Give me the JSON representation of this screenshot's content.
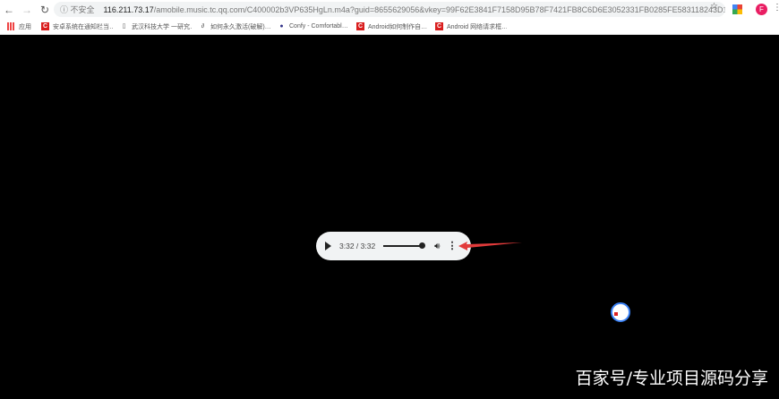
{
  "browser": {
    "security_label": "不安全",
    "url_host": "116.211.73.17",
    "url_path": "/amobile.music.tc.qq.com/C400002b3VP635HgLn.m4a?guid=8655629056&vkey=99F62E3841F7158D95B78F7421FB8C6D6E3052331FB0285FE583118243D1D...",
    "avatar_letter": "F"
  },
  "bookmarks": [
    {
      "label": "应用",
      "icon": "apps-icon"
    },
    {
      "label": "安卓系统在通知栏当…",
      "icon": "csdn-icon"
    },
    {
      "label": "武汉科技大学 一研究…",
      "icon": "page-icon"
    },
    {
      "label": "如何永久激活(破解)…",
      "icon": "link-icon"
    },
    {
      "label": "Confy - Comfortabl…",
      "icon": "confy-icon"
    },
    {
      "label": "Android如何制作自…",
      "icon": "csdn-icon"
    },
    {
      "label": "Android 网络请求框…",
      "icon": "csdn-icon"
    }
  ],
  "player": {
    "time": "3:32 / 3:32",
    "progress": 1.0
  },
  "watermark": "百家号/专业项目源码分享"
}
